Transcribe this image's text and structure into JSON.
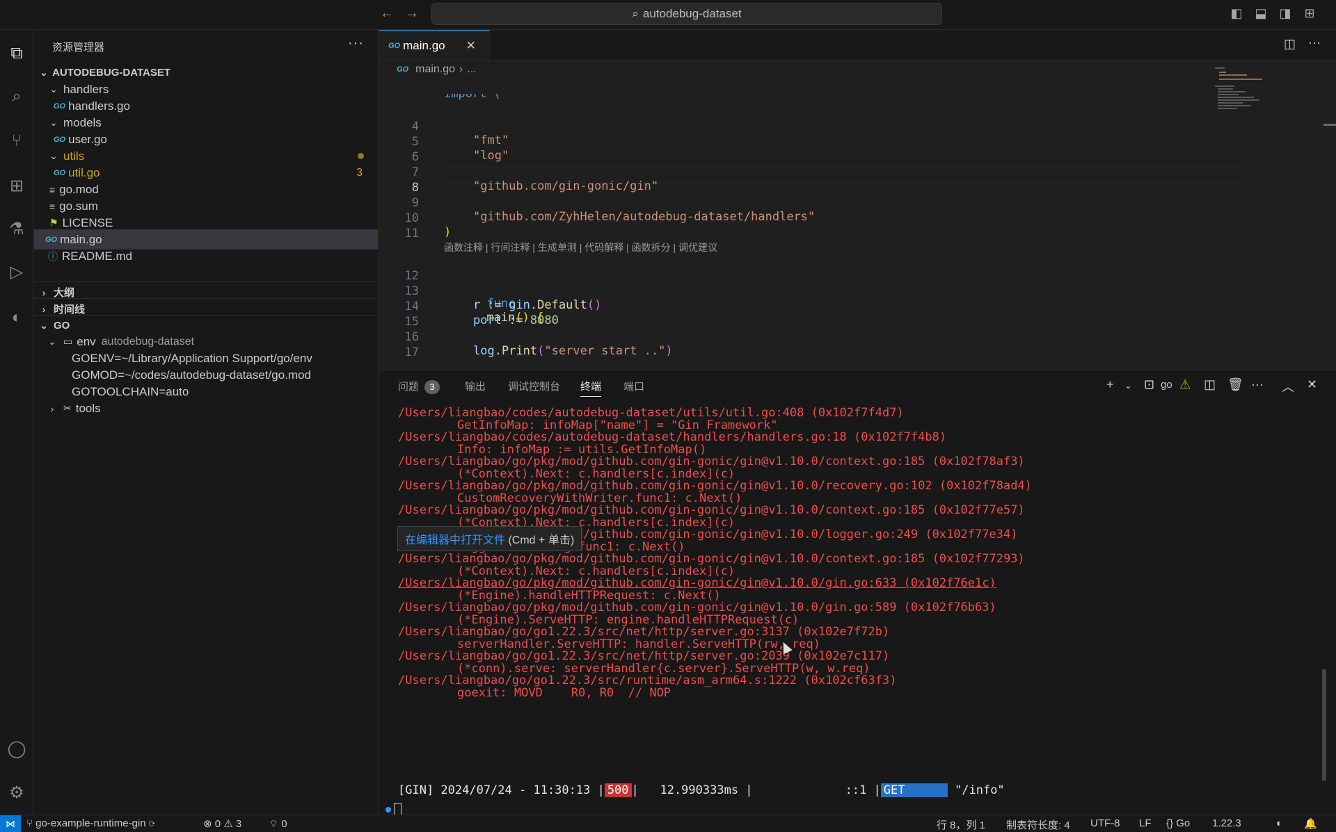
{
  "titlebar": {
    "search_text": "autodebug-dataset",
    "back_icon": "arrow-left-icon",
    "forward_icon": "arrow-right-icon"
  },
  "explorer": {
    "title": "资源管理器",
    "more": "···",
    "root": "AUTODEBUG-DATASET",
    "items": [
      {
        "label": "handlers",
        "type": "folder"
      },
      {
        "label": "handlers.go",
        "type": "go"
      },
      {
        "label": "models",
        "type": "folder"
      },
      {
        "label": "user.go",
        "type": "go"
      },
      {
        "label": "utils",
        "type": "folder"
      },
      {
        "label": "util.go",
        "type": "go",
        "badge": "3"
      },
      {
        "label": "go.mod",
        "type": "file"
      },
      {
        "label": "go.sum",
        "type": "file"
      },
      {
        "label": "LICENSE",
        "type": "license"
      },
      {
        "label": "main.go",
        "type": "go"
      },
      {
        "label": "README.md",
        "type": "info"
      }
    ],
    "sections": [
      "大纲",
      "时间线",
      "GO"
    ],
    "go_env": {
      "env_label": "env",
      "env_desc": "autodebug-dataset",
      "vars": [
        "GOENV=~/Library/Application Support/go/env",
        "GOMOD=~/codes/autodebug-dataset/go.mod",
        "GOTOOLCHAIN=auto"
      ],
      "tools": "tools"
    }
  },
  "editor": {
    "tab_label": "main.go",
    "breadcrumb_file": "main.go",
    "breadcrumb_rest": "...",
    "codelens": "函数注释 | 行间注释 | 生成单测 | 代码解释 | 函数拆分 | 调优建议",
    "line_numbers": [
      "4",
      "5",
      "6",
      "7",
      "8",
      "9",
      "10",
      "11",
      "12",
      "13",
      "14",
      "15",
      "16",
      "17"
    ],
    "lines": {
      "l3": "import (",
      "l4": "\"fmt\"",
      "l5": "\"log\"",
      "l7": "\"github.com/gin-gonic/gin\"",
      "l9": "\"github.com/ZyhHelen/autodebug-dataset/handlers\"",
      "l10": ")",
      "l12a": "func",
      "l12b": "main",
      "l12c": "() {",
      "l13a": "r",
      "l13b": " := ",
      "l13c": "gin",
      "l13d": ".",
      "l13e": "Default",
      "l13f": "()",
      "l14a": "port",
      "l14b": " := ",
      "l14c": "8080",
      "l16a": "log",
      "l16b": ".",
      "l16c": "Print",
      "l16d": "(",
      "l16e": "\"server start ..\"",
      "l16f": ")"
    }
  },
  "panel": {
    "tabs": [
      "问题",
      "输出",
      "调试控制台",
      "终端",
      "端口"
    ],
    "problems_count": "3",
    "terminal_name": "go",
    "tooltip_link": "在编辑器中打开文件",
    "tooltip_hint": "(Cmd + 单击)",
    "terminal_lines": [
      {
        "t": "/Users/liangbao/codes/autodebug-dataset/utils/util.go:408 (0x102f7f4d7)",
        "ind": false
      },
      {
        "t": "GetInfoMap: infoMap[\"name\"] = \"Gin Framework\"",
        "ind": true
      },
      {
        "t": "/Users/liangbao/codes/autodebug-dataset/handlers/handlers.go:18 (0x102f7f4b8)",
        "ind": false
      },
      {
        "t": "Info: infoMap := utils.GetInfoMap()",
        "ind": true
      },
      {
        "t": "/Users/liangbao/go/pkg/mod/github.com/gin-gonic/gin@v1.10.0/context.go:185 (0x102f78af3)",
        "ind": false
      },
      {
        "t": "(*Context).Next: c.handlers[c.index](c)",
        "ind": true
      },
      {
        "t": "/Users/liangbao/go/pkg/mod/github.com/gin-gonic/gin@v1.10.0/recovery.go:102 (0x102f78ad4)",
        "ind": false
      },
      {
        "t": "CustomRecoveryWithWriter.func1: c.Next()",
        "ind": true
      },
      {
        "t": "/Users/liangbao/go/pkg/mod/github.com/gin-gonic/gin@v1.10.0/context.go:185 (0x102f77e57)",
        "ind": false
      },
      {
        "t": "(*Context).Next: c.handlers[c.index](c)",
        "ind": true
      },
      {
        "t": "/Users/liangbao/go/pkg/mod/github.com/gin-gonic/gin@v1.10.0/logger.go:249 (0x102f77e34)",
        "ind": false
      },
      {
        "t": "LoggerWithConfig.func1: c.Next()",
        "ind": true
      },
      {
        "t": "/Users/liangbao/go/pkg/mod/github.com/gin-gonic/gin@v1.10.0/context.go:185 (0x102f77293)",
        "ind": false
      },
      {
        "t": "(*Context).Next: c.handlers[c.index](c)",
        "ind": true
      },
      {
        "t": "/Users/liangbao/go/pkg/mod/github.com/gin-gonic/gin@v1.10.0/gin.go:633 (0x102f76e1c)",
        "ind": false
      },
      {
        "t": "(*Engine).handleHTTPRequest: c.Next()",
        "ind": true
      },
      {
        "t": "/Users/liangbao/go/pkg/mod/github.com/gin-gonic/gin@v1.10.0/gin.go:589 (0x102f76b63)",
        "ind": false
      },
      {
        "t": "(*Engine).ServeHTTP: engine.handleHTTPRequest(c)",
        "ind": true
      },
      {
        "t": "/Users/liangbao/go/go1.22.3/src/net/http/server.go:3137 (0x102e7f72b)",
        "ind": false
      },
      {
        "t": "serverHandler.ServeHTTP: handler.ServeHTTP(rw, req)",
        "ind": true
      },
      {
        "t": "/Users/liangbao/go/go1.22.3/src/net/http/server.go:2039 (0x102e7c117)",
        "ind": false
      },
      {
        "t": "(*conn).serve: serverHandler{c.server}.ServeHTTP(w, w.req)",
        "ind": true
      },
      {
        "t": "/Users/liangbao/go/go1.22.3/src/runtime/asm_arm64.s:1222 (0x102cf63f3)",
        "ind": false
      },
      {
        "t": "goexit: MOVD    R0, R0  // NOP",
        "ind": true
      }
    ],
    "gin_log": {
      "prefix": "[GIN] 2024/07/24 - 11:30:13 |",
      "status": "500",
      "middle": "|   12.990333ms |             ::1 |",
      "method": "GET",
      "path": "\"/info\""
    }
  },
  "statusbar": {
    "branch": "go-example-runtime-gin",
    "errors": "0",
    "warnings": "3",
    "ports": "0",
    "position": "行 8，列 1",
    "tab_size": "制表符长度: 4",
    "encoding": "UTF-8",
    "eol": "LF",
    "language": "Go",
    "go_version": "1.22.3"
  }
}
